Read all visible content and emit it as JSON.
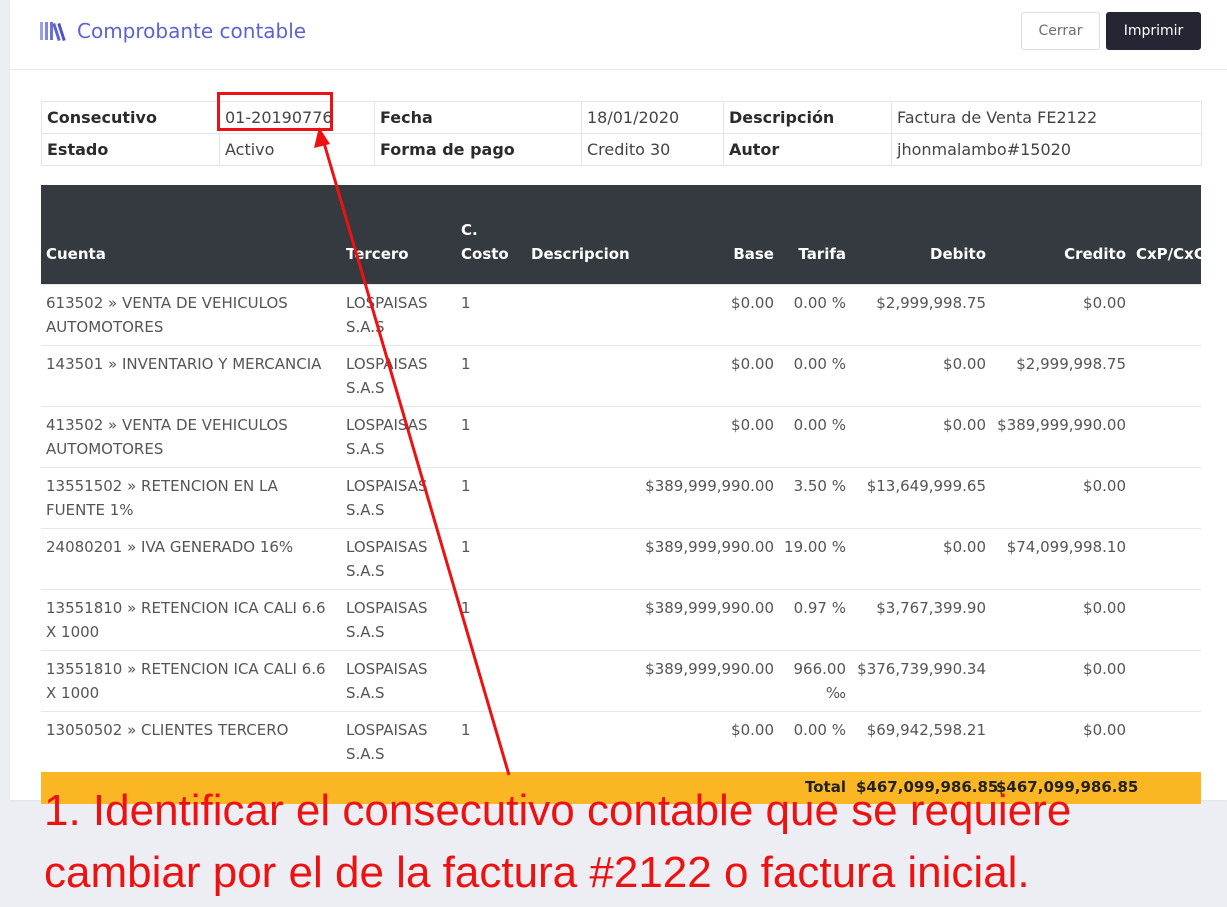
{
  "header": {
    "icon": "books-icon",
    "title": "Comprobante contable",
    "close_label": "Cerrar",
    "print_label": "Imprimir"
  },
  "info": {
    "consecutivo_label": "Consecutivo",
    "consecutivo_value": "01-20190776",
    "fecha_label": "Fecha",
    "fecha_value": "18/01/2020",
    "descripcion_label": "Descripción",
    "descripcion_value": "Factura de Venta FE2122",
    "estado_label": "Estado",
    "estado_value": "Activo",
    "forma_pago_label": "Forma de pago",
    "forma_pago_value": "Credito 30",
    "autor_label": "Autor",
    "autor_value": "jhonmalambo#15020"
  },
  "table": {
    "headers": [
      "Cuenta",
      "Tercero",
      "C. Costo",
      "Descripcion",
      "Base",
      "Tarifa",
      "Debito",
      "Credito",
      "CxP/CxC"
    ],
    "rows": [
      {
        "cuenta": "613502 » VENTA DE VEHICULOS AUTOMOTORES",
        "tercero": "LOSPAISAS S.A.S",
        "costo": "1",
        "descripcion": "",
        "base": "$0.00",
        "tarifa": "0.00 %",
        "debito": "$2,999,998.75",
        "credito": "$0.00",
        "cxp": ""
      },
      {
        "cuenta": "143501 » INVENTARIO Y MERCANCIA",
        "tercero": "LOSPAISAS S.A.S",
        "costo": "1",
        "descripcion": "",
        "base": "$0.00",
        "tarifa": "0.00 %",
        "debito": "$0.00",
        "credito": "$2,999,998.75",
        "cxp": ""
      },
      {
        "cuenta": "413502 » VENTA DE VEHICULOS AUTOMOTORES",
        "tercero": "LOSPAISAS S.A.S",
        "costo": "1",
        "descripcion": "",
        "base": "$0.00",
        "tarifa": "0.00 %",
        "debito": "$0.00",
        "credito": "$389,999,990.00",
        "cxp": ""
      },
      {
        "cuenta": "13551502 » RETENCION EN LA FUENTE 1%",
        "tercero": "LOSPAISAS S.A.S",
        "costo": "1",
        "descripcion": "",
        "base": "$389,999,990.00",
        "tarifa": "3.50 %",
        "debito": "$13,649,999.65",
        "credito": "$0.00",
        "cxp": ""
      },
      {
        "cuenta": "24080201 » IVA GENERADO 16%",
        "tercero": "LOSPAISAS S.A.S",
        "costo": "1",
        "descripcion": "",
        "base": "$389,999,990.00",
        "tarifa": "19.00 %",
        "debito": "$0.00",
        "credito": "$74,099,998.10",
        "cxp": ""
      },
      {
        "cuenta": "13551810 » RETENCION ICA CALI 6.6 X 1000",
        "tercero": "LOSPAISAS S.A.S",
        "costo": "1",
        "descripcion": "",
        "base": "$389,999,990.00",
        "tarifa": "0.97 %",
        "debito": "$3,767,399.90",
        "credito": "$0.00",
        "cxp": ""
      },
      {
        "cuenta": "13551810 » RETENCION ICA CALI 6.6 X 1000",
        "tercero": "LOSPAISAS S.A.S",
        "costo": "",
        "descripcion": "",
        "base": "$389,999,990.00",
        "tarifa": "966.00 ‰",
        "debito": "$376,739,990.34",
        "credito": "$0.00",
        "cxp": ""
      },
      {
        "cuenta": "13050502 » CLIENTES TERCERO",
        "tercero": "LOSPAISAS S.A.S",
        "costo": "1",
        "descripcion": "",
        "base": "$0.00",
        "tarifa": "0.00 %",
        "debito": "$69,942,598.21",
        "credito": "$0.00",
        "cxp": ""
      }
    ],
    "total_label": "Total",
    "total_debito": "$467,099,986.85",
    "total_credito": "$467,099,986.85"
  },
  "annotation": {
    "text": "1. Identificar el consecutivo contable que se requiere cambiar por el de la factura #2122 o factura inicial.",
    "color": "#ee1111"
  }
}
